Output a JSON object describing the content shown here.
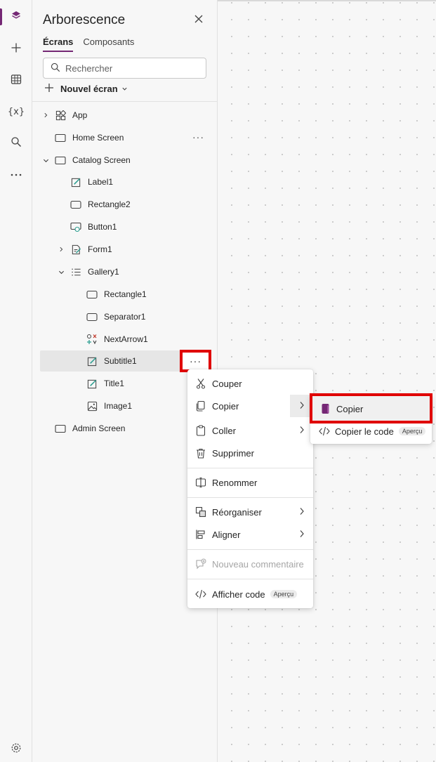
{
  "rail": {
    "items": [
      {
        "name": "tree-view",
        "icon": "layers-icon",
        "active": true
      },
      {
        "name": "insert",
        "icon": "plus-icon"
      },
      {
        "name": "data",
        "icon": "table-icon"
      },
      {
        "name": "variables",
        "icon": "variables-icon",
        "text": "{x}"
      },
      {
        "name": "search",
        "icon": "search-icon"
      },
      {
        "name": "more",
        "icon": "more-icon"
      }
    ],
    "settings_icon": "gear-icon",
    "accent": "#742774"
  },
  "panel": {
    "title": "Arborescence",
    "tabs": [
      {
        "label": "Écrans",
        "active": true
      },
      {
        "label": "Composants",
        "active": false
      }
    ],
    "search_placeholder": "Rechercher",
    "new_screen_label": "Nouvel écran"
  },
  "tree": {
    "items": [
      {
        "label": "App"
      },
      {
        "label": "Home Screen"
      },
      {
        "label": "Catalog Screen"
      },
      {
        "label": "Label1"
      },
      {
        "label": "Rectangle2"
      },
      {
        "label": "Button1"
      },
      {
        "label": "Form1"
      },
      {
        "label": "Gallery1"
      },
      {
        "label": "Rectangle1"
      },
      {
        "label": "Separator1"
      },
      {
        "label": "NextArrow1"
      },
      {
        "label": "Subtitle1",
        "selected": true
      },
      {
        "label": "Title1"
      },
      {
        "label": "Image1"
      },
      {
        "label": "Admin Screen"
      }
    ],
    "more_glyph": "···"
  },
  "context_menu": {
    "items": [
      {
        "label": "Couper",
        "icon": "scissors-icon"
      },
      {
        "label": "Copier",
        "icon": "copy-icon",
        "submenu": true
      },
      {
        "label": "Coller",
        "icon": "paste-icon",
        "submenu": true
      },
      {
        "label": "Supprimer",
        "icon": "trash-icon"
      },
      {
        "label": "Renommer",
        "icon": "rename-icon"
      },
      {
        "label": "Réorganiser",
        "icon": "reorder-icon",
        "submenu": true
      },
      {
        "label": "Aligner",
        "icon": "align-icon",
        "submenu": true
      },
      {
        "label": "Nouveau commentaire",
        "icon": "comment-icon",
        "disabled": true
      },
      {
        "label": "Afficher code",
        "icon": "code-icon",
        "badge": "Aperçu"
      }
    ]
  },
  "submenu": {
    "items": [
      {
        "label": "Copier",
        "icon": "copy-filled-icon"
      },
      {
        "label": "Copier le code",
        "icon": "code-icon",
        "badge": "Aperçu"
      }
    ]
  },
  "highlight_color": "#e00000"
}
